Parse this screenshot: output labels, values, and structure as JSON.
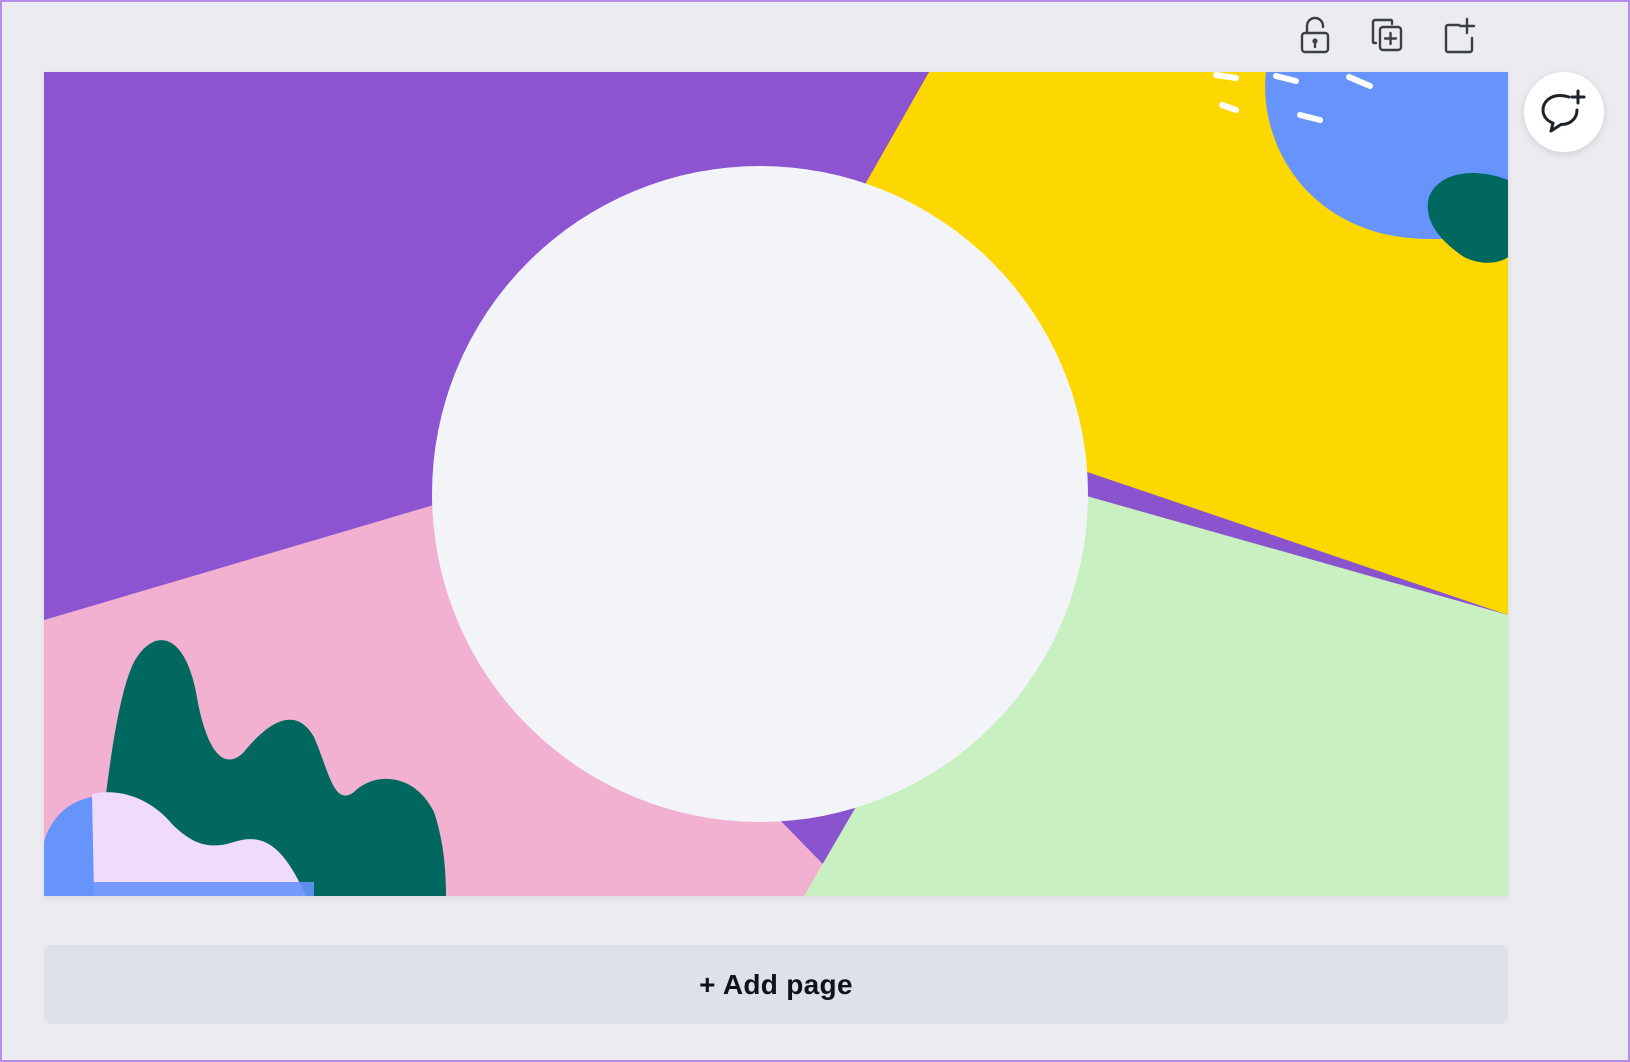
{
  "toolbar": {
    "icons": [
      "unlock-icon",
      "duplicate-page-icon",
      "add-page-icon"
    ]
  },
  "canvas": {
    "colors": {
      "purple": "#8b54cf",
      "yellow": "#fdd800",
      "pink": "#f2b1d0",
      "green": "#c8f0c0",
      "circle": "#f3f4f8",
      "blue_blob": "#6694fb",
      "teal": "#00685f",
      "lilac": "#f0dcfa"
    }
  },
  "comment": {
    "icon": "add-comment-icon"
  },
  "add_page": {
    "label": "+ Add page"
  }
}
